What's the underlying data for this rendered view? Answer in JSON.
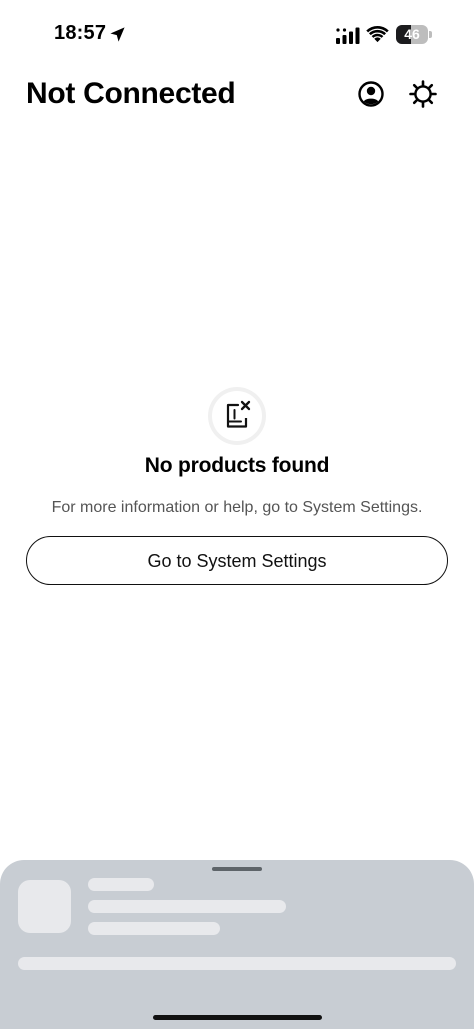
{
  "status_bar": {
    "time": "18:57",
    "battery_level": "46",
    "battery_fraction": 0.46,
    "icons": [
      "location-arrow-icon",
      "cellular-signal-icon",
      "wifi-icon",
      "battery-icon"
    ]
  },
  "header": {
    "title": "Not Connected",
    "icons": [
      "account-icon",
      "settings-gear-icon"
    ]
  },
  "empty_state": {
    "icon": "no-products-icon",
    "title": "No products found",
    "description": "For more information or help, go to System Settings.",
    "button_label": "Go to System Settings"
  },
  "colors": {
    "background": "#ffffff",
    "text_primary": "#000000",
    "text_secondary": "#555555",
    "sheet_background": "#c8cdd3",
    "skeleton": "#e8e9ec"
  }
}
